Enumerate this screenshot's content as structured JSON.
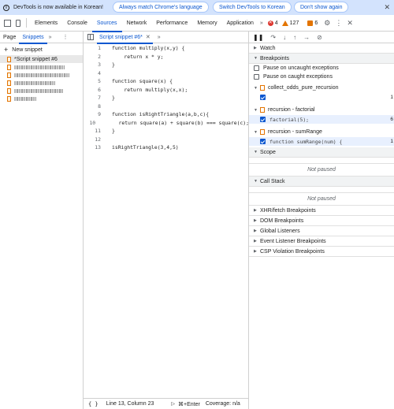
{
  "infobar": {
    "message": "DevTools is now available in Korean!",
    "btn_match": "Always match Chrome's language",
    "btn_switch": "Switch DevTools to Korean",
    "btn_dont": "Don't show again"
  },
  "toptabs": {
    "tabs": [
      "Elements",
      "Console",
      "Sources",
      "Network",
      "Performance",
      "Memory",
      "Application"
    ],
    "active": "Sources",
    "more": "»",
    "errors": "4",
    "warnings": "127",
    "issues": "6"
  },
  "navigator": {
    "tab_page": "Page",
    "tab_snippets": "Snippets",
    "more": "»",
    "new_snippet": "New snippet",
    "snippets": [
      "*Script snippet #6",
      "",
      "",
      "",
      "",
      ""
    ]
  },
  "editor": {
    "tab_label": "Script snippet #6*",
    "more": "»",
    "lines": [
      {
        "n": "1",
        "text": "function multiply(x,y) {"
      },
      {
        "n": "2",
        "text": "    return x * y;"
      },
      {
        "n": "3",
        "text": "}"
      },
      {
        "n": "4",
        "text": ""
      },
      {
        "n": "5",
        "text": "function square(x) {"
      },
      {
        "n": "6",
        "text": "    return multiply(x,x);"
      },
      {
        "n": "7",
        "text": "}"
      },
      {
        "n": "8",
        "text": ""
      },
      {
        "n": "9",
        "text": "function isRightTriangle(a,b,c){"
      },
      {
        "n": "10",
        "text": "    return square(a) + square(b) === square(c);"
      },
      {
        "n": "11",
        "text": "}"
      },
      {
        "n": "12",
        "text": ""
      },
      {
        "n": "13",
        "text": "isRightTriangle(3,4,5)"
      }
    ],
    "status_brace": "{ }",
    "status_position": "Line 13, Column 23",
    "status_run": "▷",
    "status_shortcut": "⌘+Enter",
    "status_coverage": "Coverage: n/a"
  },
  "debugger": {
    "watch": "Watch",
    "breakpoints": "Breakpoints",
    "pause_uncaught": "Pause on uncaught exceptions",
    "pause_caught": "Pause on caught exceptions",
    "bp_groups": [
      {
        "file": "collect_odds_pure_recursion",
        "code": "",
        "line": "1"
      },
      {
        "file": "recursion - factorial",
        "code": "factorial(5);",
        "line": "6"
      },
      {
        "file": "recursion - sumRange",
        "code": "function sumRange(num) {",
        "line": "1"
      }
    ],
    "scope": "Scope",
    "not_paused_1": "Not paused",
    "call_stack": "Call Stack",
    "not_paused_2": "Not paused",
    "xhr": "XHR/fetch Breakpoints",
    "dom": "DOM Breakpoints",
    "global": "Global Listeners",
    "event": "Event Listener Breakpoints",
    "csp": "CSP Violation Breakpoints"
  }
}
